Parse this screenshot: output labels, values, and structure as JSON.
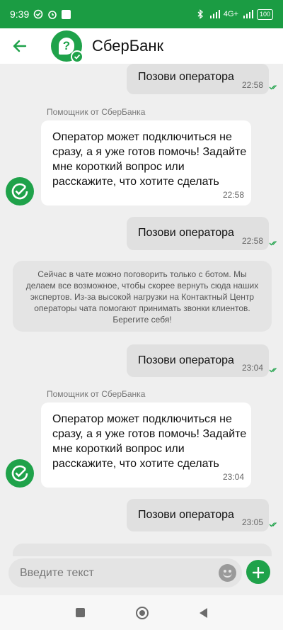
{
  "status": {
    "time": "9:39",
    "network": "4G+",
    "battery": "100"
  },
  "header": {
    "title": "СберБанк",
    "avatar_icon": "question-icon"
  },
  "chat": {
    "messages": [
      {
        "type": "outgoing",
        "text": "Позови оператора",
        "time": "22:58"
      },
      {
        "type": "incoming",
        "sender": "Помощник от СберБанка",
        "text": "Оператор может подключиться не сразу, а я уже готов помочь! Задайте мне короткий вопрос или расскажите, что хотите сделать",
        "time": "22:58"
      },
      {
        "type": "outgoing",
        "text": "Позови оператора",
        "time": "22:58"
      },
      {
        "type": "system",
        "text": "Сейчас в чате можно поговорить только с ботом. Мы делаем все возможное, чтобы скорее вернуть сюда наших экспертов. Из-за высокой нагрузки на Контактный Центр операторы чата помогают принимать звонки клиентов. Берегите себя!"
      },
      {
        "type": "outgoing",
        "text": "Позови оператора",
        "time": "23:04"
      },
      {
        "type": "incoming",
        "sender": "Помощник от СберБанка",
        "text": "Оператор может подключиться не сразу, а я уже готов помочь! Задайте мне короткий вопрос или расскажите, что хотите сделать",
        "time": "23:04"
      },
      {
        "type": "outgoing",
        "text": "Позови оператора",
        "time": "23:05"
      }
    ]
  },
  "input": {
    "placeholder": "Введите текст",
    "value": ""
  },
  "colors": {
    "brand": "#1fa24a",
    "statusbar": "#1b9c43",
    "outgoing_bubble": "#e0e0e0",
    "incoming_bubble": "#ffffff",
    "background": "#efefef"
  }
}
